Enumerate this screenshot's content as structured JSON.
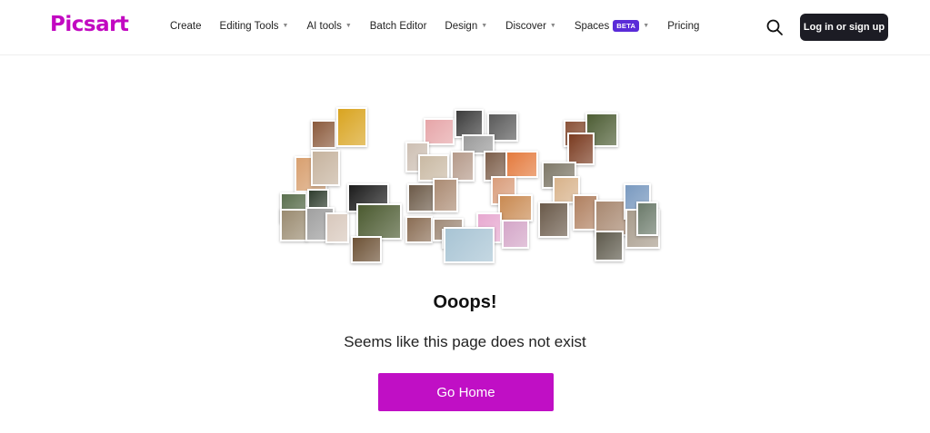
{
  "brand": {
    "logo_text": "Picsart",
    "logo_color": "#c209c1"
  },
  "nav": {
    "items": [
      {
        "label": "Create",
        "dropdown": false
      },
      {
        "label": "Editing Tools",
        "dropdown": true
      },
      {
        "label": "AI tools",
        "dropdown": true
      },
      {
        "label": "Batch Editor",
        "dropdown": false
      },
      {
        "label": "Design",
        "dropdown": true
      },
      {
        "label": "Discover",
        "dropdown": true
      },
      {
        "label": "Spaces",
        "dropdown": true,
        "badge": "BETA"
      },
      {
        "label": "Pricing",
        "dropdown": false
      }
    ],
    "search_icon": "search-icon",
    "login_label": "Log in or sign up"
  },
  "error": {
    "title": "Ooops!",
    "message": "Seems like this page does not exist",
    "button_label": "Go Home"
  },
  "colors": {
    "accent": "#c00fc5",
    "badge": "#5a2bd8",
    "login_bg": "#1c1c24"
  },
  "collage": {
    "digits": "404",
    "photo_count": 44
  }
}
